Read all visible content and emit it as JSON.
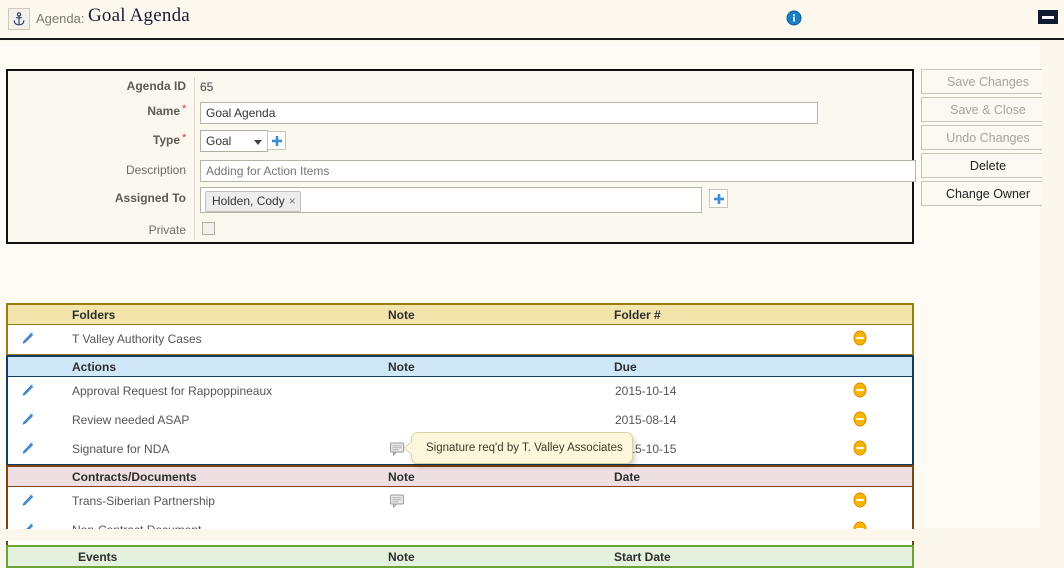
{
  "titlebar": {
    "entity_label": "Agenda:",
    "title": "Goal Agenda",
    "anchor_icon": "anchor-icon",
    "info_icon": "info-icon",
    "minimize_icon": "minimize-icon"
  },
  "detail": {
    "fields": [
      {
        "label": "Agenda ID",
        "value": "65",
        "required": false
      },
      {
        "label": "Name",
        "value": "Goal Agenda",
        "required": true
      },
      {
        "label": "Type",
        "value": "Goal",
        "required": true
      },
      {
        "label": "Description",
        "value": "",
        "placeholder": "Adding for Action Items",
        "required": false
      },
      {
        "label": "Assigned To",
        "value": "",
        "required": false
      },
      {
        "label": "Private",
        "value": "",
        "required": false
      }
    ],
    "required_marker": "*",
    "assigned_to_chip": "Holden, Cody",
    "chip_remove_label": "×",
    "type_add_icon": "plus-icon",
    "assigned_add_icon": "plus-icon",
    "private_checked": false
  },
  "buttons": [
    {
      "label": "Save Changes",
      "disabled": true
    },
    {
      "label": "Save & Close",
      "disabled": true
    },
    {
      "label": "Undo Changes",
      "disabled": true
    },
    {
      "label": "Delete",
      "disabled": false
    },
    {
      "label": "Change Owner",
      "disabled": false
    }
  ],
  "sections": [
    {
      "key": "folders",
      "columns": [
        "Folders",
        "Note",
        "Folder #"
      ],
      "rows": [
        {
          "name": "T Valley Authority Cases",
          "note": "",
          "date": "",
          "has_note_icon": false
        }
      ]
    },
    {
      "key": "actions",
      "columns": [
        "Actions",
        "Note",
        "Due"
      ],
      "rows": [
        {
          "name": "Approval Request for Rappoppineaux",
          "note": "",
          "date": "2015-10-14",
          "has_note_icon": false
        },
        {
          "name": "Review needed ASAP",
          "note": "",
          "date": "2015-08-14",
          "has_note_icon": false
        },
        {
          "name": "Signature for NDA",
          "note": "Signature req'd by T. Valley Associates",
          "date": "2015-10-15",
          "has_note_icon": true
        }
      ]
    },
    {
      "key": "contracts",
      "columns": [
        "Contracts/Documents",
        "Note",
        "Date"
      ],
      "rows": [
        {
          "name": "Trans-Siberian Partnership",
          "note": "",
          "date": "",
          "has_note_icon": true
        },
        {
          "name": "Non-Contract Document",
          "note": "",
          "date": "",
          "has_note_icon": false
        }
      ]
    },
    {
      "key": "events",
      "columns": [
        "Events",
        "Note",
        "Start Date"
      ],
      "rows": []
    }
  ],
  "tooltip": {
    "text": "Signature req'd by T. Valley Associates",
    "visible": true
  },
  "icons": {
    "row_edit": "pencil-icon",
    "row_delete": "remove-circle-icon",
    "note": "note-icon"
  },
  "colors": {
    "page_background": "#fbf7ec",
    "folders_header": "#f2e4ab",
    "folders_border": "#9a7d12",
    "actions_header": "#cfe7f7",
    "actions_border": "#0d3d63",
    "contracts_header": "#eee0e2",
    "contracts_border": "#7d4410",
    "events_header": "#e4f1dc",
    "events_border": "#6aa436",
    "tooltip_background": "#fdf8dc",
    "delete_icon": "#f5a000",
    "accent_blue": "#3b8ed0"
  }
}
